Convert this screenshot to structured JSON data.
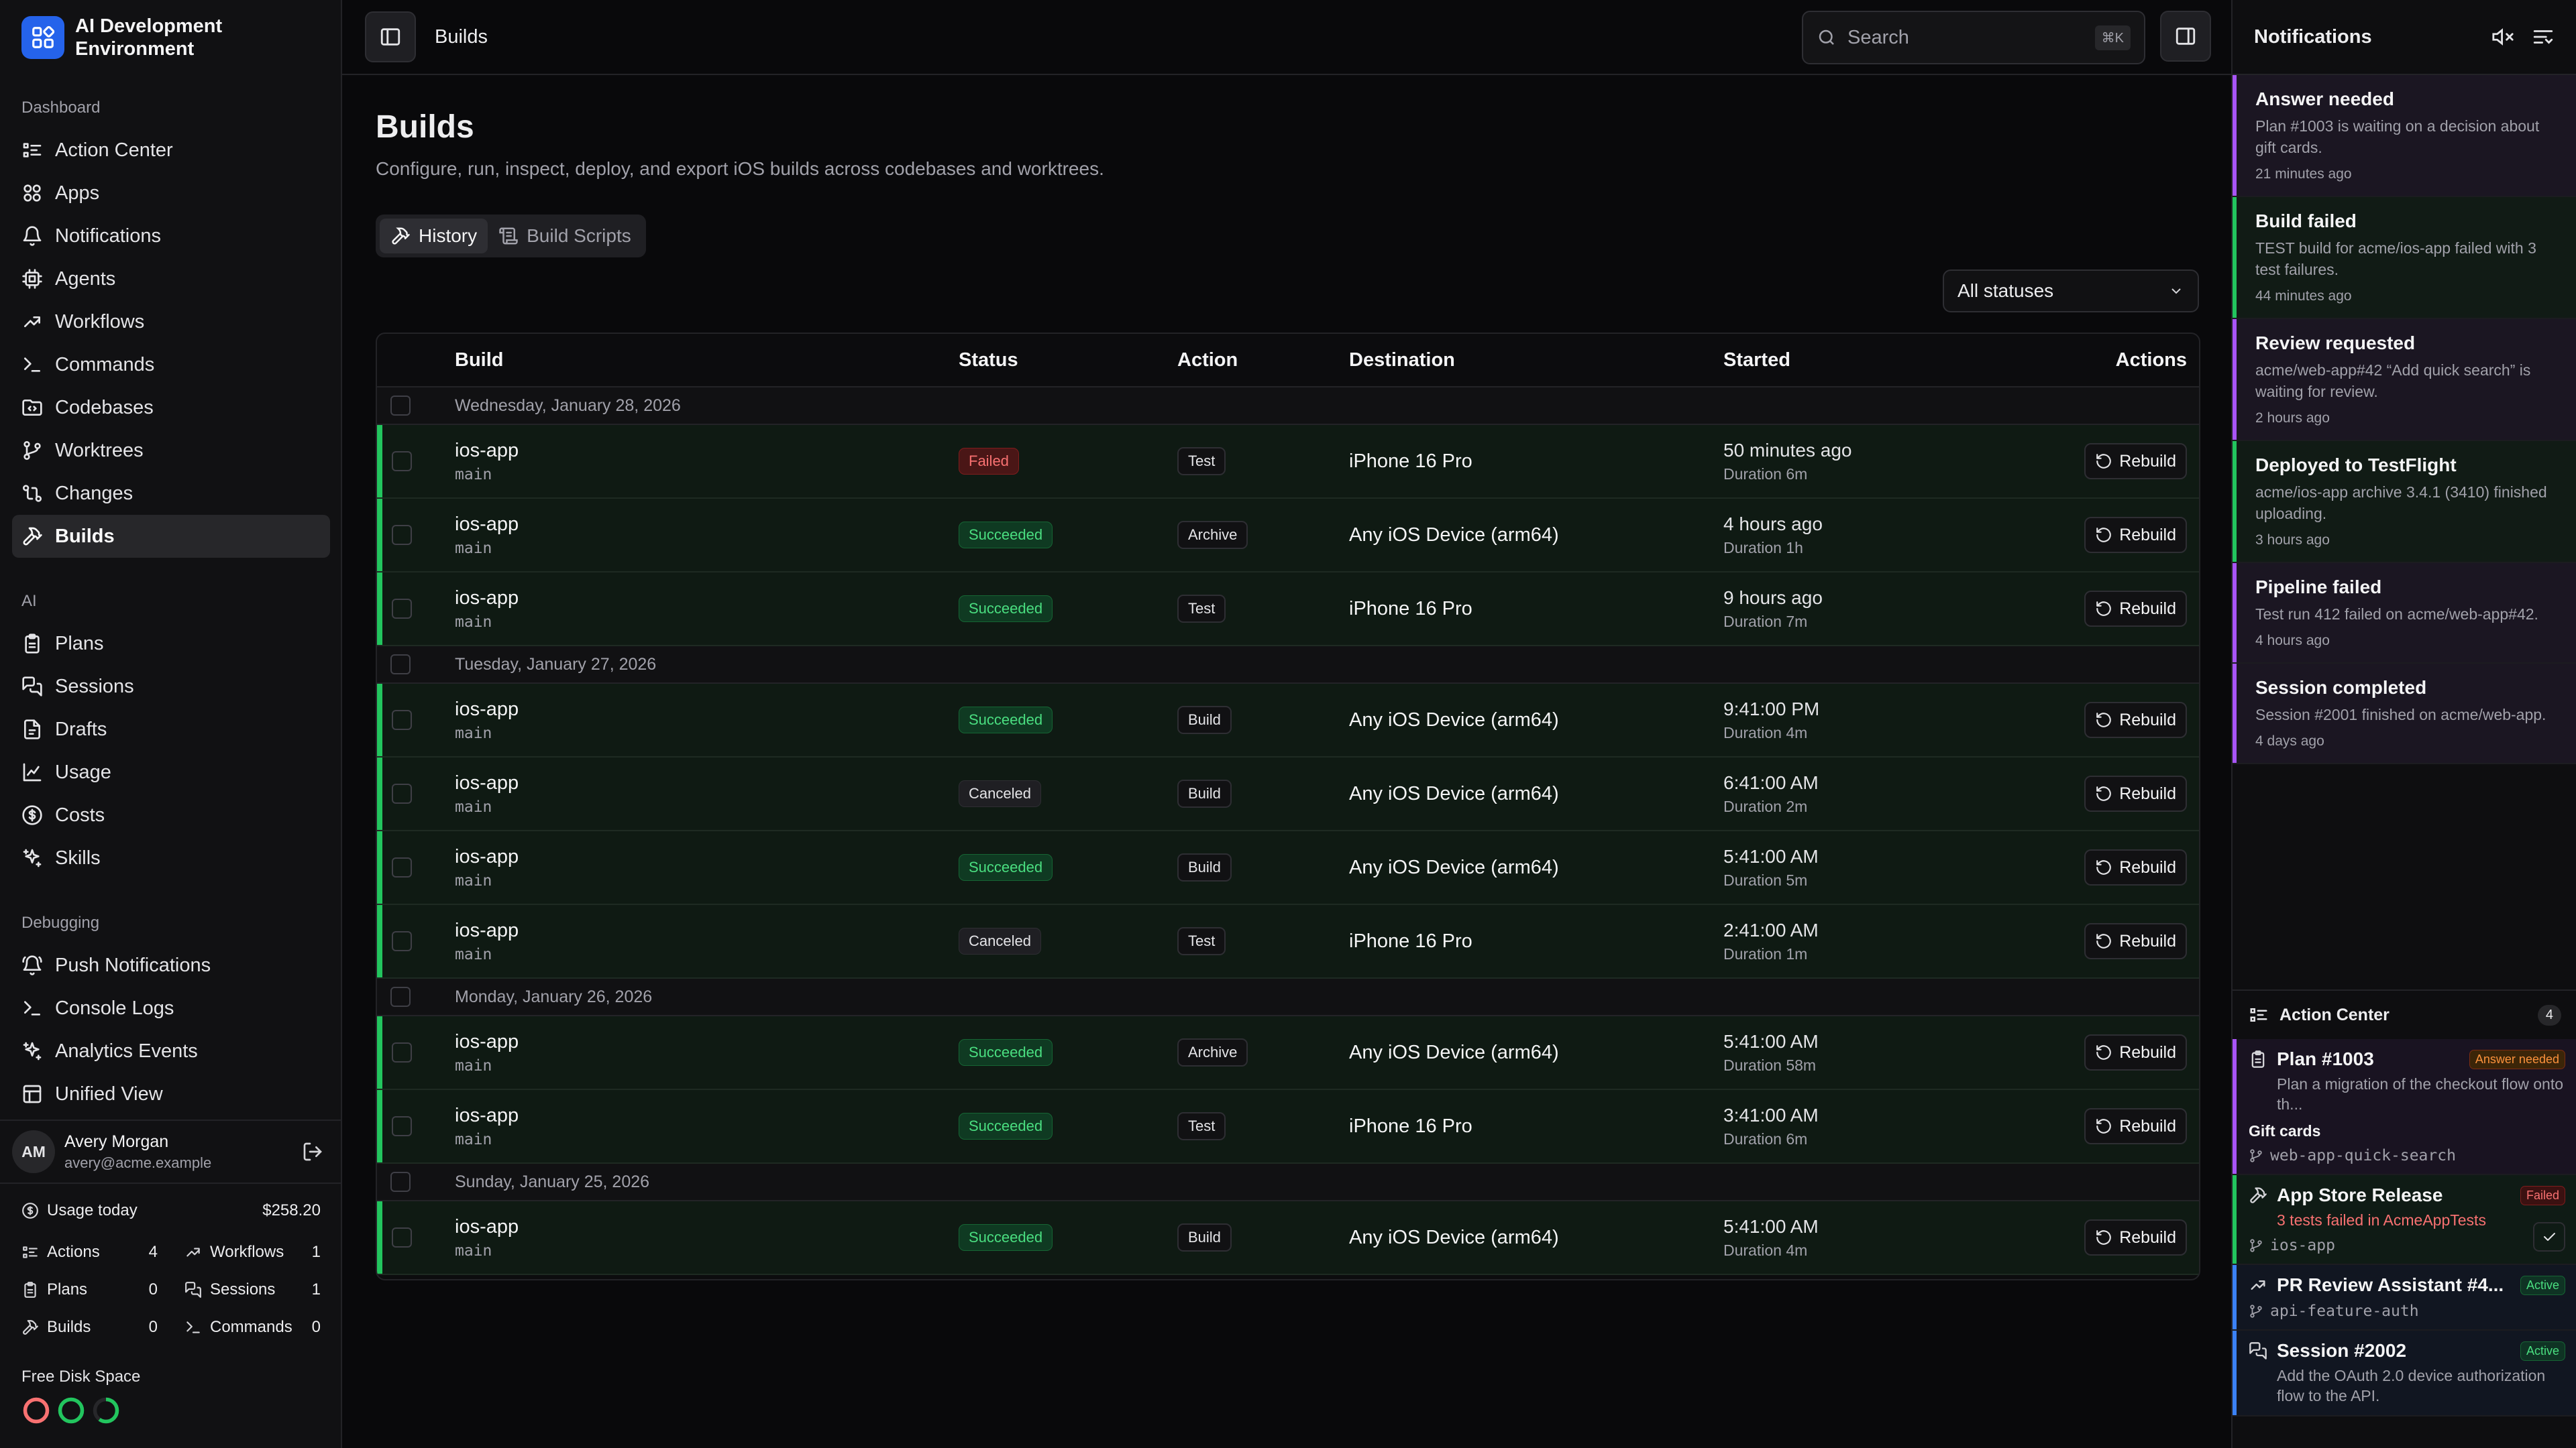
{
  "app": {
    "name": "AI Development Environment"
  },
  "sidebar": {
    "sections": [
      {
        "title": "Dashboard",
        "items": [
          {
            "label": "Action Center",
            "icon": "list-checks-icon"
          },
          {
            "label": "Apps",
            "icon": "apps-icon"
          },
          {
            "label": "Notifications",
            "icon": "bell-icon"
          },
          {
            "label": "Agents",
            "icon": "cpu-icon"
          },
          {
            "label": "Workflows",
            "icon": "workflow-icon"
          },
          {
            "label": "Commands",
            "icon": "terminal-icon"
          },
          {
            "label": "Codebases",
            "icon": "folder-code-icon"
          },
          {
            "label": "Worktrees",
            "icon": "git-branch-icon"
          },
          {
            "label": "Changes",
            "icon": "git-compare-icon"
          },
          {
            "label": "Builds",
            "icon": "hammer-icon",
            "active": true
          }
        ]
      },
      {
        "title": "AI",
        "items": [
          {
            "label": "Plans",
            "icon": "clipboard-icon"
          },
          {
            "label": "Sessions",
            "icon": "chat-icon"
          },
          {
            "label": "Drafts",
            "icon": "draft-icon"
          },
          {
            "label": "Usage",
            "icon": "chart-icon"
          },
          {
            "label": "Costs",
            "icon": "dollar-icon"
          },
          {
            "label": "Skills",
            "icon": "sparkles-icon"
          }
        ]
      },
      {
        "title": "Debugging",
        "items": [
          {
            "label": "Push Notifications",
            "icon": "bell-ring-icon"
          },
          {
            "label": "Console Logs",
            "icon": "terminal-icon"
          },
          {
            "label": "Analytics Events",
            "icon": "sparkles-icon"
          },
          {
            "label": "Unified View",
            "icon": "layout-icon"
          }
        ]
      }
    ],
    "user": {
      "initials": "AM",
      "name": "Avery Morgan",
      "email": "avery@acme.example"
    },
    "usage": {
      "title": "Usage today",
      "amount": "$258.20",
      "stats": [
        {
          "label": "Actions",
          "value": "4",
          "icon": "list-checks-icon"
        },
        {
          "label": "Workflows",
          "value": "1",
          "icon": "workflow-icon"
        },
        {
          "label": "Plans",
          "value": "0",
          "icon": "clipboard-icon"
        },
        {
          "label": "Sessions",
          "value": "1",
          "icon": "chat-icon"
        },
        {
          "label": "Builds",
          "value": "0",
          "icon": "hammer-icon"
        },
        {
          "label": "Commands",
          "value": "0",
          "icon": "terminal-icon"
        }
      ]
    },
    "disk": {
      "title": "Free Disk Space",
      "rings": [
        {
          "color": "#f87171",
          "fraction": 1.0
        },
        {
          "color": "#22c55e",
          "fraction": 1.0
        },
        {
          "color": "#22c55e",
          "fraction": 0.6
        }
      ]
    }
  },
  "topbar": {
    "breadcrumb": "Builds",
    "search_placeholder": "Search",
    "shortcut": "⌘K"
  },
  "page": {
    "title": "Builds",
    "subtitle": "Configure, run, inspect, deploy, and export iOS builds across codebases and worktrees.",
    "tabs": [
      {
        "label": "History",
        "active": true
      },
      {
        "label": "Build Scripts",
        "active": false
      }
    ],
    "filter": "All statuses",
    "columns": {
      "build": "Build",
      "status": "Status",
      "action": "Action",
      "destination": "Destination",
      "started": "Started",
      "actions": "Actions"
    },
    "rebuild_label": "Rebuild",
    "groups": [
      {
        "date": "Wednesday, January 28, 2026",
        "rows": [
          {
            "name": "ios-app",
            "branch": "main",
            "status": "Failed",
            "action": "Test",
            "destination": "iPhone 16 Pro",
            "started": "50 minutes ago",
            "duration": "Duration 6m"
          },
          {
            "name": "ios-app",
            "branch": "main",
            "status": "Succeeded",
            "action": "Archive",
            "destination": "Any iOS Device (arm64)",
            "started": "4 hours ago",
            "duration": "Duration 1h"
          },
          {
            "name": "ios-app",
            "branch": "main",
            "status": "Succeeded",
            "action": "Test",
            "destination": "iPhone 16 Pro",
            "started": "9 hours ago",
            "duration": "Duration 7m"
          }
        ]
      },
      {
        "date": "Tuesday, January 27, 2026",
        "rows": [
          {
            "name": "ios-app",
            "branch": "main",
            "status": "Succeeded",
            "action": "Build",
            "destination": "Any iOS Device (arm64)",
            "started": "9:41:00 PM",
            "duration": "Duration 4m"
          },
          {
            "name": "ios-app",
            "branch": "main",
            "status": "Canceled",
            "action": "Build",
            "destination": "Any iOS Device (arm64)",
            "started": "6:41:00 AM",
            "duration": "Duration 2m"
          },
          {
            "name": "ios-app",
            "branch": "main",
            "status": "Succeeded",
            "action": "Build",
            "destination": "Any iOS Device (arm64)",
            "started": "5:41:00 AM",
            "duration": "Duration 5m"
          },
          {
            "name": "ios-app",
            "branch": "main",
            "status": "Canceled",
            "action": "Test",
            "destination": "iPhone 16 Pro",
            "started": "2:41:00 AM",
            "duration": "Duration 1m"
          }
        ]
      },
      {
        "date": "Monday, January 26, 2026",
        "rows": [
          {
            "name": "ios-app",
            "branch": "main",
            "status": "Succeeded",
            "action": "Archive",
            "destination": "Any iOS Device (arm64)",
            "started": "5:41:00 AM",
            "duration": "Duration 58m"
          },
          {
            "name": "ios-app",
            "branch": "main",
            "status": "Succeeded",
            "action": "Test",
            "destination": "iPhone 16 Pro",
            "started": "3:41:00 AM",
            "duration": "Duration 6m"
          }
        ]
      },
      {
        "date": "Sunday, January 25, 2026",
        "rows": [
          {
            "name": "ios-app",
            "branch": "main",
            "status": "Succeeded",
            "action": "Build",
            "destination": "Any iOS Device (arm64)",
            "started": "5:41:00 AM",
            "duration": "Duration 4m"
          }
        ]
      }
    ]
  },
  "notifications": {
    "title": "Notifications",
    "items": [
      {
        "title": "Answer needed",
        "body": "Plan #1003 is waiting on a decision about gift cards.",
        "time": "21 minutes ago",
        "accent": "purple"
      },
      {
        "title": "Build failed",
        "body": "TEST build for acme/ios-app failed with 3 test failures.",
        "time": "44 minutes ago",
        "accent": "green"
      },
      {
        "title": "Review requested",
        "body": "acme/web-app#42 “Add quick search” is waiting for review.",
        "time": "2 hours ago",
        "accent": "purple"
      },
      {
        "title": "Deployed to TestFlight",
        "body": "acme/ios-app archive 3.4.1 (3410) finished uploading.",
        "time": "3 hours ago",
        "accent": "green"
      },
      {
        "title": "Pipeline failed",
        "body": "Test run 412 failed on acme/web-app#42.",
        "time": "4 hours ago",
        "accent": "purple"
      },
      {
        "title": "Session completed",
        "body": "Session #2001 finished on acme/web-app.",
        "time": "4 days ago",
        "accent": "purple"
      }
    ]
  },
  "action_center": {
    "title": "Action Center",
    "count": "4",
    "items": [
      {
        "title": "Plan #1003",
        "badge": "Answer needed",
        "badge_style": "orange",
        "desc": "Plan a migration of the checkout flow onto th...",
        "extra": "Gift cards",
        "branch": "web-app-quick-search",
        "icon": "clipboard-icon",
        "accent": "#a855f7"
      },
      {
        "title": "App Store Release",
        "badge": "Failed",
        "badge_style": "red",
        "desc": "3 tests failed in AcmeAppTests",
        "desc_red": true,
        "branch": "ios-app",
        "icon": "hammer-icon",
        "accent": "#22c55e",
        "check": true
      },
      {
        "title": "PR Review Assistant #4...",
        "badge": "Active",
        "badge_style": "green",
        "branch": "api-feature-auth",
        "icon": "workflow-icon",
        "accent": "#3b82f6"
      },
      {
        "title": "Session #2002",
        "badge": "Active",
        "badge_style": "green",
        "desc": "Add the OAuth 2.0 device authorization flow to the API.",
        "icon": "chat-icon",
        "accent": "#3b82f6"
      }
    ]
  }
}
